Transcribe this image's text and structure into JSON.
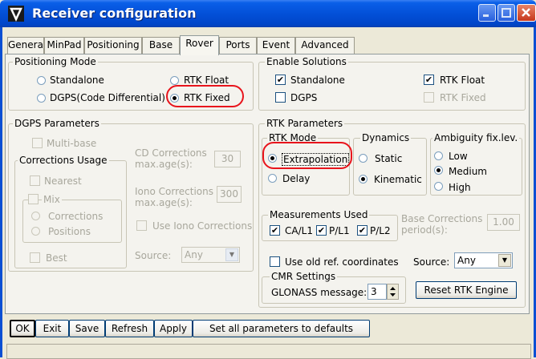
{
  "window": {
    "title": "Receiver configuration"
  },
  "tabs": [
    "General",
    "MinPad",
    "Positioning",
    "Base",
    "Rover",
    "Ports",
    "Event",
    "Advanced"
  ],
  "positioning_mode": {
    "legend": "Positioning Mode",
    "standalone": "Standalone",
    "dgps": "DGPS(Code Differential)",
    "rtk_float": "RTK Float",
    "rtk_fixed": "RTK Fixed"
  },
  "enable_solutions": {
    "legend": "Enable Solutions",
    "standalone": "Standalone",
    "rtk_float": "RTK Float",
    "dgps": "DGPS",
    "rtk_fixed": "RTK Fixed"
  },
  "dgps_params": {
    "legend": "DGPS Parameters",
    "multi_base": "Multi-base",
    "corrections_usage": "Corrections Usage",
    "nearest": "Nearest",
    "mix": "Mix",
    "corrections": "Corrections",
    "positions": "Positions",
    "best": "Best",
    "cd_label_1": "CD Corrections",
    "cd_label_2": "max.age(s):",
    "cd_value": "30",
    "iono_label_1": "Iono Corrections",
    "iono_label_2": "max.age(s):",
    "iono_value": "300",
    "use_iono": "Use Iono Corrections",
    "source_label": "Source:",
    "source_value": "Any"
  },
  "rtk_params": {
    "legend": "RTK Parameters",
    "rtk_mode": "RTK Mode",
    "extrapolation": "Extrapolation",
    "delay": "Delay",
    "dynamics": "Dynamics",
    "static": "Static",
    "kinematic": "Kinematic",
    "ambiguity": "Ambiguity fix.lev.",
    "low": "Low",
    "medium": "Medium",
    "high": "High",
    "measurements": "Measurements Used",
    "ca_l1": "CA/L1",
    "p_l1": "P/L1",
    "p_l2": "P/L2",
    "base_corr_1": "Base Corrections",
    "base_corr_2": "period(s):",
    "base_corr_value": "1.00",
    "use_old_ref": "Use old ref. coordinates",
    "source_label": "Source:",
    "source_value": "Any",
    "cmr_settings": "CMR Settings",
    "glonass_label": "GLONASS message:",
    "glonass_value": "3",
    "reset_button": "Reset RTK Engine"
  },
  "bottom_buttons": {
    "ok": "OK",
    "exit": "Exit",
    "save": "Save",
    "refresh": "Refresh",
    "apply": "Apply",
    "defaults": "Set all parameters to defaults"
  },
  "colors": {
    "titlebar": "#0350D8",
    "highlight": "#E8141C",
    "dialog": "#ECE9D8"
  }
}
